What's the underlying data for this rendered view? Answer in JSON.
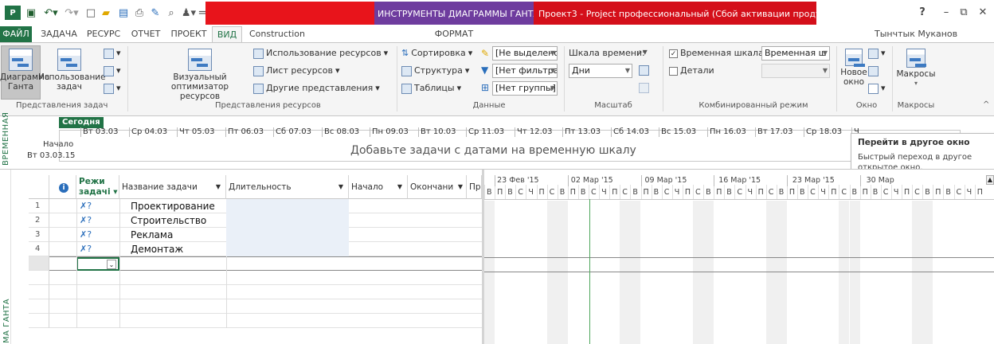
{
  "titlebar": {
    "context_tools": "ИНСТРУМЕНТЫ ДИАГРАММЫ ГАНТА",
    "window_title": "Проект3 - Project профессиональный (Сбой активации продукта)",
    "help": "?",
    "user": "Тынчтык Муканов"
  },
  "tabs": {
    "file": "ФАЙЛ",
    "task": "ЗАДАЧА",
    "resource": "РЕСУРС",
    "report": "ОТЧЕТ",
    "project": "ПРОЕКТ",
    "view": "ВИД",
    "construction": "Construction",
    "format": "ФОРМАТ"
  },
  "ribbon": {
    "gantt_chart": "Диаграмма Ганта",
    "task_usage": "Использование задач",
    "task_views_label": "Представления задач",
    "visual_optimizer": "Визуальный оптимизатор ресурсов",
    "resource_usage": "Использование ресурсов",
    "resource_sheet": "Лист ресурсов",
    "other_views": "Другие представления",
    "resource_views_label": "Представления ресурсов",
    "sorting": "Сортировка",
    "outline": "Структура",
    "tables": "Таблицы",
    "highlight": "[Не выделено",
    "filter": "[Нет фильтра]",
    "group": "[Нет группы]",
    "data_label": "Данные",
    "timescale": "Шкала времени:",
    "days": "Дни",
    "scale_label": "Масштаб",
    "timeline_check": "Временная шкала",
    "timeline_combo": "Временная ш",
    "details": "Детали",
    "split_label": "Комбинированный режим",
    "new_window": "Новое окно",
    "window_label": "Окно",
    "macros": "Макросы",
    "macros_label": "Макросы"
  },
  "timeline": {
    "side_label": "ВРЕМЕННАЯ",
    "today": "Сегодня",
    "start_label": "Начало",
    "start_date": "Вт 03.03.15",
    "dates": [
      "Вт 03.03",
      "Ср 04.03",
      "Чт 05.03",
      "Пт 06.03",
      "Сб 07.03",
      "Вс 08.03",
      "Пн 09.03",
      "Вт 10.03",
      "Ср 11.03",
      "Чт 12.03",
      "Пт 13.03",
      "Сб 14.03",
      "Вс 15.03",
      "Пн 16.03",
      "Вт 17.03",
      "Ср 18.03",
      "Ч"
    ],
    "hint": "Добавьте задачи с датами на временную шкалу"
  },
  "tooltip": {
    "title": "Перейти в другое окно",
    "body": "Быстрый переход в другое открытое окно."
  },
  "grid": {
    "side_label": "МА ГАНТА",
    "headers": {
      "info": "i",
      "mode_line1": "Режи",
      "mode_line2": "задачі",
      "name": "Название задачи",
      "duration": "Длительность",
      "start": "Начало",
      "finish": "Окончани",
      "pred": "Пр"
    },
    "rows": [
      {
        "id": "1",
        "name": "Проектирование"
      },
      {
        "id": "2",
        "name": "Строительство"
      },
      {
        "id": "3",
        "name": "Реклама"
      },
      {
        "id": "4",
        "name": "Демонтаж"
      }
    ]
  },
  "gantt": {
    "weeks": [
      "23 Фев '15",
      "02 Мар '15",
      "09 Мар '15",
      "16 Мар '15",
      "23 Мар '15",
      "30 Мар"
    ],
    "days": [
      "В",
      "П",
      "В",
      "С",
      "Ч",
      "П",
      "С"
    ]
  }
}
